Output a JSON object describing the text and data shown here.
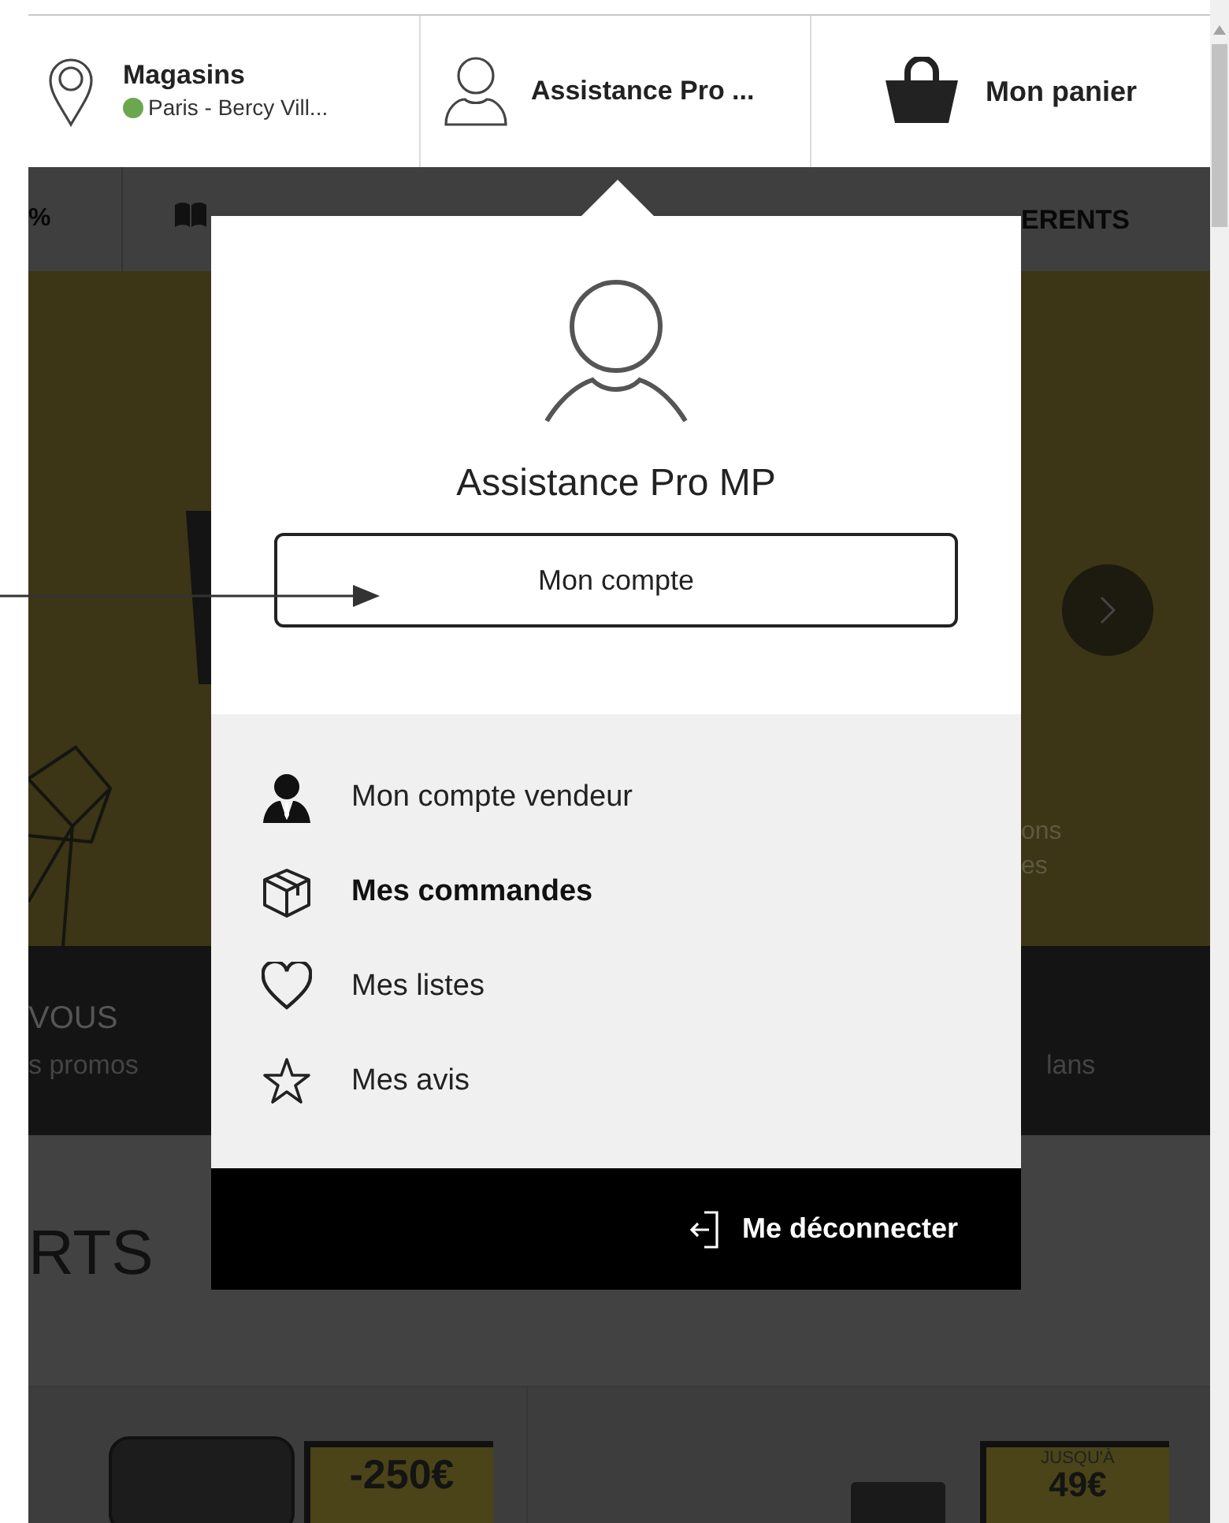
{
  "header": {
    "stores": {
      "title": "Magasins",
      "location": "Paris - Bercy Vill..."
    },
    "account": {
      "label": "Assistance Pro ..."
    },
    "cart": {
      "label": "Mon panier"
    }
  },
  "nav": [
    {
      "label": "%"
    },
    {
      "label": "ERENTS"
    }
  ],
  "banner": {
    "side_texts": [
      "ons",
      "es"
    ]
  },
  "promo_band": {
    "title": "VOUS",
    "subtitle": "s promos",
    "right_text": "lans"
  },
  "section_title": "RTS",
  "products": [
    {
      "badge": "-250€"
    },
    {
      "badge_top": "JUSQU'À",
      "badge": "49€"
    }
  ],
  "account_menu": {
    "name": "Assistance Pro MP",
    "account_button": "Mon compte",
    "items": [
      {
        "kind": "seller",
        "label": "Mon compte vendeur",
        "selected": false
      },
      {
        "kind": "orders",
        "label": "Mes commandes",
        "selected": true
      },
      {
        "kind": "lists",
        "label": "Mes listes",
        "selected": false
      },
      {
        "kind": "reviews",
        "label": "Mes avis",
        "selected": false
      }
    ],
    "logout": "Me déconnecter"
  }
}
